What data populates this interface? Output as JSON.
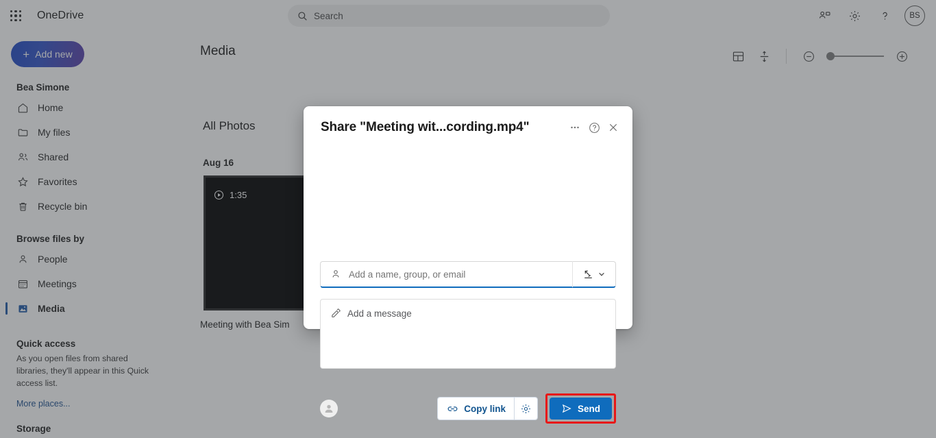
{
  "suite": {
    "waffle_label": "app-launcher",
    "brand": "OneDrive",
    "search_placeholder": "Search",
    "right_icons": [
      {
        "name": "meet-now-icon",
        "label": "Meet now"
      },
      {
        "name": "gear-icon",
        "label": "Settings"
      },
      {
        "name": "help-icon",
        "label": "Help"
      }
    ],
    "avatar_initials": "BS"
  },
  "sidebar": {
    "add_new_label": "Add new",
    "account_name": "Bea Simone",
    "primary_items": [
      {
        "label": "Home",
        "icon": "home-icon",
        "selected": false
      },
      {
        "label": "My files",
        "icon": "folder-icon",
        "selected": false
      },
      {
        "label": "Shared",
        "icon": "people-icon",
        "selected": false
      },
      {
        "label": "Favorites",
        "icon": "star-icon",
        "selected": false
      },
      {
        "label": "Recycle bin",
        "icon": "trash-icon",
        "selected": false
      }
    ],
    "browse_heading": "Browse files by",
    "browse_items": [
      {
        "label": "People",
        "icon": "person-icon",
        "selected": false
      },
      {
        "label": "Meetings",
        "icon": "calendar-icon",
        "selected": false
      },
      {
        "label": "Media",
        "icon": "photo-icon",
        "selected": true
      }
    ],
    "quick_access_heading": "Quick access",
    "quick_access_body": "As you open files from shared libraries, they'll appear in this Quick access list.",
    "more_places_label": "More places...",
    "storage_heading": "Storage"
  },
  "content": {
    "page_title": "Media",
    "group_title": "All Photos",
    "date_label": "Aug 16",
    "toolbar": {
      "layout_icon": "tiles-layout-icon",
      "fit_icon": "expand-vertical-icon",
      "zoom_out_icon": "zoom-out-icon",
      "zoom_in_icon": "zoom-in-icon"
    },
    "tile": {
      "duration": "1:35",
      "play_icon": "play-circle-icon",
      "caption": "Meeting with Bea Sim"
    }
  },
  "modal": {
    "title": "Share \"Meeting wit...cording.mp4\"",
    "header_icons": [
      {
        "name": "more-options-icon",
        "label": "More options"
      },
      {
        "name": "help-icon",
        "label": "Help"
      },
      {
        "name": "close-icon",
        "label": "Close"
      }
    ],
    "people_field": {
      "placeholder": "Add a name, group, or email",
      "value": "",
      "person_icon": "person-add-icon",
      "permission_icon": "signature-permission-icon",
      "chevron_icon": "chevron-down-icon"
    },
    "message_field": {
      "placeholder": "Add a message",
      "value": "",
      "icon": "edit-pencil-icon"
    },
    "footer": {
      "owner_avatar": "generic-person-avatar",
      "copy_link_label": "Copy link",
      "copy_link_icon": "link-icon",
      "link_settings_icon": "gear-icon",
      "send_label": "Send",
      "send_icon": "send-plane-icon"
    }
  },
  "highlight": {
    "target": "send-button",
    "color": "#e81717"
  },
  "colors": {
    "accent_blue": "#0f6cbd",
    "link_blue": "#11548f",
    "scrim": "rgba(56,60,64,0.45)",
    "sidebar_selected": "#1f5aa8"
  }
}
